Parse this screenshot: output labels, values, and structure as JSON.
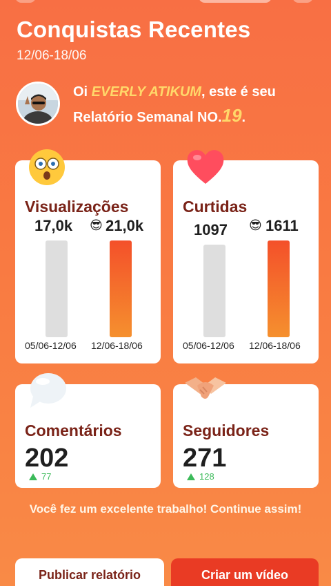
{
  "header": {
    "title": "Conquistas Recentes",
    "date_range": "12/06-18/06"
  },
  "greeting": {
    "prefix": "Oi ",
    "user_name": "EVERLY ATIKUM",
    "middle": ", este é seu Relatório Semanal NO.",
    "report_number": "19",
    "suffix": "."
  },
  "views": {
    "label": "Visualizações",
    "previous_value": "17,0k",
    "current_value": "21,0k",
    "previous_period": "05/06-12/06",
    "current_period": "12/06-18/06"
  },
  "likes": {
    "label": "Curtidas",
    "previous_value": "1097",
    "current_value": "1611",
    "previous_period": "05/06-12/06",
    "current_period": "12/06-18/06"
  },
  "comments": {
    "label": "Comentários",
    "value": "202",
    "delta": "77"
  },
  "followers": {
    "label": "Seguidores",
    "value": "271",
    "delta": "128"
  },
  "message": "Você fez um excelente trabalho! Continue assim!",
  "buttons": {
    "publish": "Publicar relatório",
    "create_video": "Criar um vídeo"
  },
  "colors": {
    "accent": "#e93b24",
    "highlight": "#ffd86a",
    "label_text": "#7a2318",
    "delta_green": "#3cba5a"
  },
  "icons": {
    "views": "surprised-face-icon",
    "likes": "heart-icon",
    "comments": "speech-bubble-icon",
    "followers": "handshake-icon",
    "cool": "sunglasses-face-icon"
  }
}
